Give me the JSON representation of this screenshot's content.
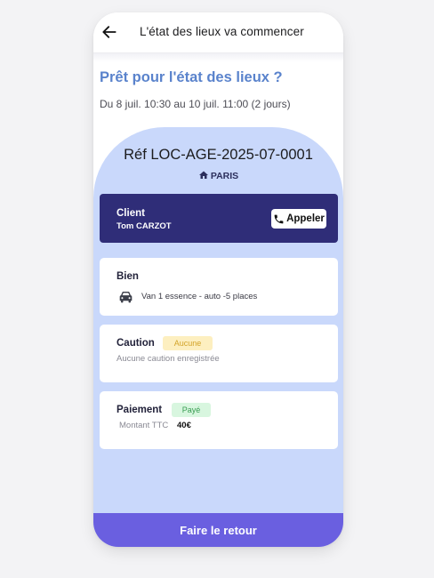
{
  "header": {
    "title": "L'état des lieux va commencer"
  },
  "intro": {
    "title": "Prêt pour l'état des lieux ?",
    "dates": "Du 8 juil. 10:30 au 10 juil. 11:00  (2 jours)"
  },
  "rental": {
    "reference": "Réf LOC-AGE-2025-07-0001",
    "location": "PARIS"
  },
  "client": {
    "label": "Client",
    "name": "Tom CARZOT",
    "call_label": "Appeler"
  },
  "bien": {
    "label": "Bien",
    "vehicle": "Van 1 essence - auto -5 places",
    "icon": "car-icon"
  },
  "caution": {
    "label": "Caution",
    "badge": "Aucune",
    "badge_color": "#fdefc0",
    "description": "Aucune caution enregistrée"
  },
  "paiement": {
    "label": "Paiement",
    "badge": "Payé",
    "badge_color": "#d8f6df",
    "amount_label": "Montant TTC",
    "amount": "40€"
  },
  "footer": {
    "button_label": "Faire le retour"
  },
  "colors": {
    "accent": "#6a5fe0",
    "client_card": "#2f2d78",
    "panel": "#c9d8fb",
    "title_blue": "#5a83cc"
  }
}
